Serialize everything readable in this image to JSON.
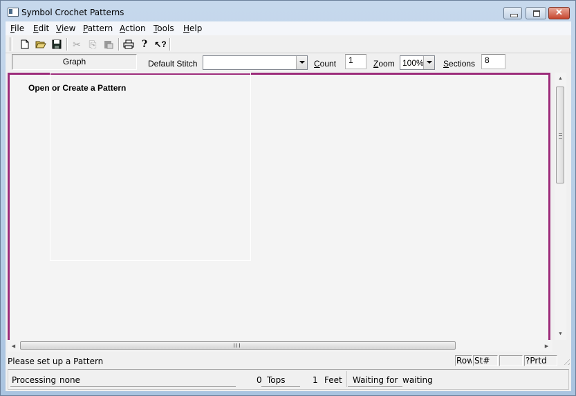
{
  "window": {
    "title": "Symbol Crochet Patterns",
    "controls": {
      "minimize": "minimize",
      "maximize": "maximize",
      "close": "✕"
    }
  },
  "menu": [
    {
      "label": "File",
      "accel": "F",
      "rest": "ile"
    },
    {
      "label": "Edit",
      "accel": "E",
      "rest": "dit"
    },
    {
      "label": "View",
      "accel": "V",
      "rest": "iew"
    },
    {
      "label": "Pattern",
      "accel": "P",
      "rest": "attern"
    },
    {
      "label": "Action",
      "accel": "A",
      "rest": "ction"
    },
    {
      "label": "Tools",
      "accel": "T",
      "rest": "ools"
    },
    {
      "label": "Help",
      "accel": "H",
      "rest": "elp"
    }
  ],
  "toolbar": {
    "buttons": [
      {
        "name": "new-document",
        "glyph": "🗋",
        "enabled": true
      },
      {
        "name": "open-folder",
        "glyph": "📂",
        "enabled": true
      },
      {
        "name": "save",
        "glyph": "💾",
        "enabled": true
      },
      {
        "name": "cut",
        "glyph": "✂",
        "enabled": false
      },
      {
        "name": "copy",
        "glyph": "⎘",
        "enabled": false
      },
      {
        "name": "paste",
        "glyph": "📋",
        "enabled": false
      },
      {
        "name": "print",
        "glyph": "🖶",
        "enabled": true
      },
      {
        "name": "help",
        "glyph": "?",
        "enabled": true
      },
      {
        "name": "context-help",
        "glyph": "↖?",
        "enabled": true
      }
    ]
  },
  "options": {
    "graph_button": "Graph",
    "default_stitch_label": "Default Stitch",
    "default_stitch_value": "",
    "count_label_accel": "C",
    "count_label_rest": "ount",
    "count_value": "1",
    "zoom_label_accel": "Z",
    "zoom_label_rest": "oom",
    "zoom_value": "100%",
    "sections_label_accel": "S",
    "sections_label_rest": "ections",
    "sections_value": "8"
  },
  "canvas": {
    "message": "Open or Create a Pattern",
    "border_color": "#9c2b7a"
  },
  "status_bar": {
    "message": "Please set up a Pattern",
    "panels": [
      "Row",
      "St#",
      "",
      "?Prtd"
    ]
  },
  "progress_bar": {
    "processing_label": "Processing",
    "processing_value": "none",
    "tops_count": "0",
    "tops_label": "Tops",
    "feet_count": "1",
    "feet_label": "Feet",
    "waiting_label": "Waiting for",
    "waiting_value": "waiting"
  }
}
